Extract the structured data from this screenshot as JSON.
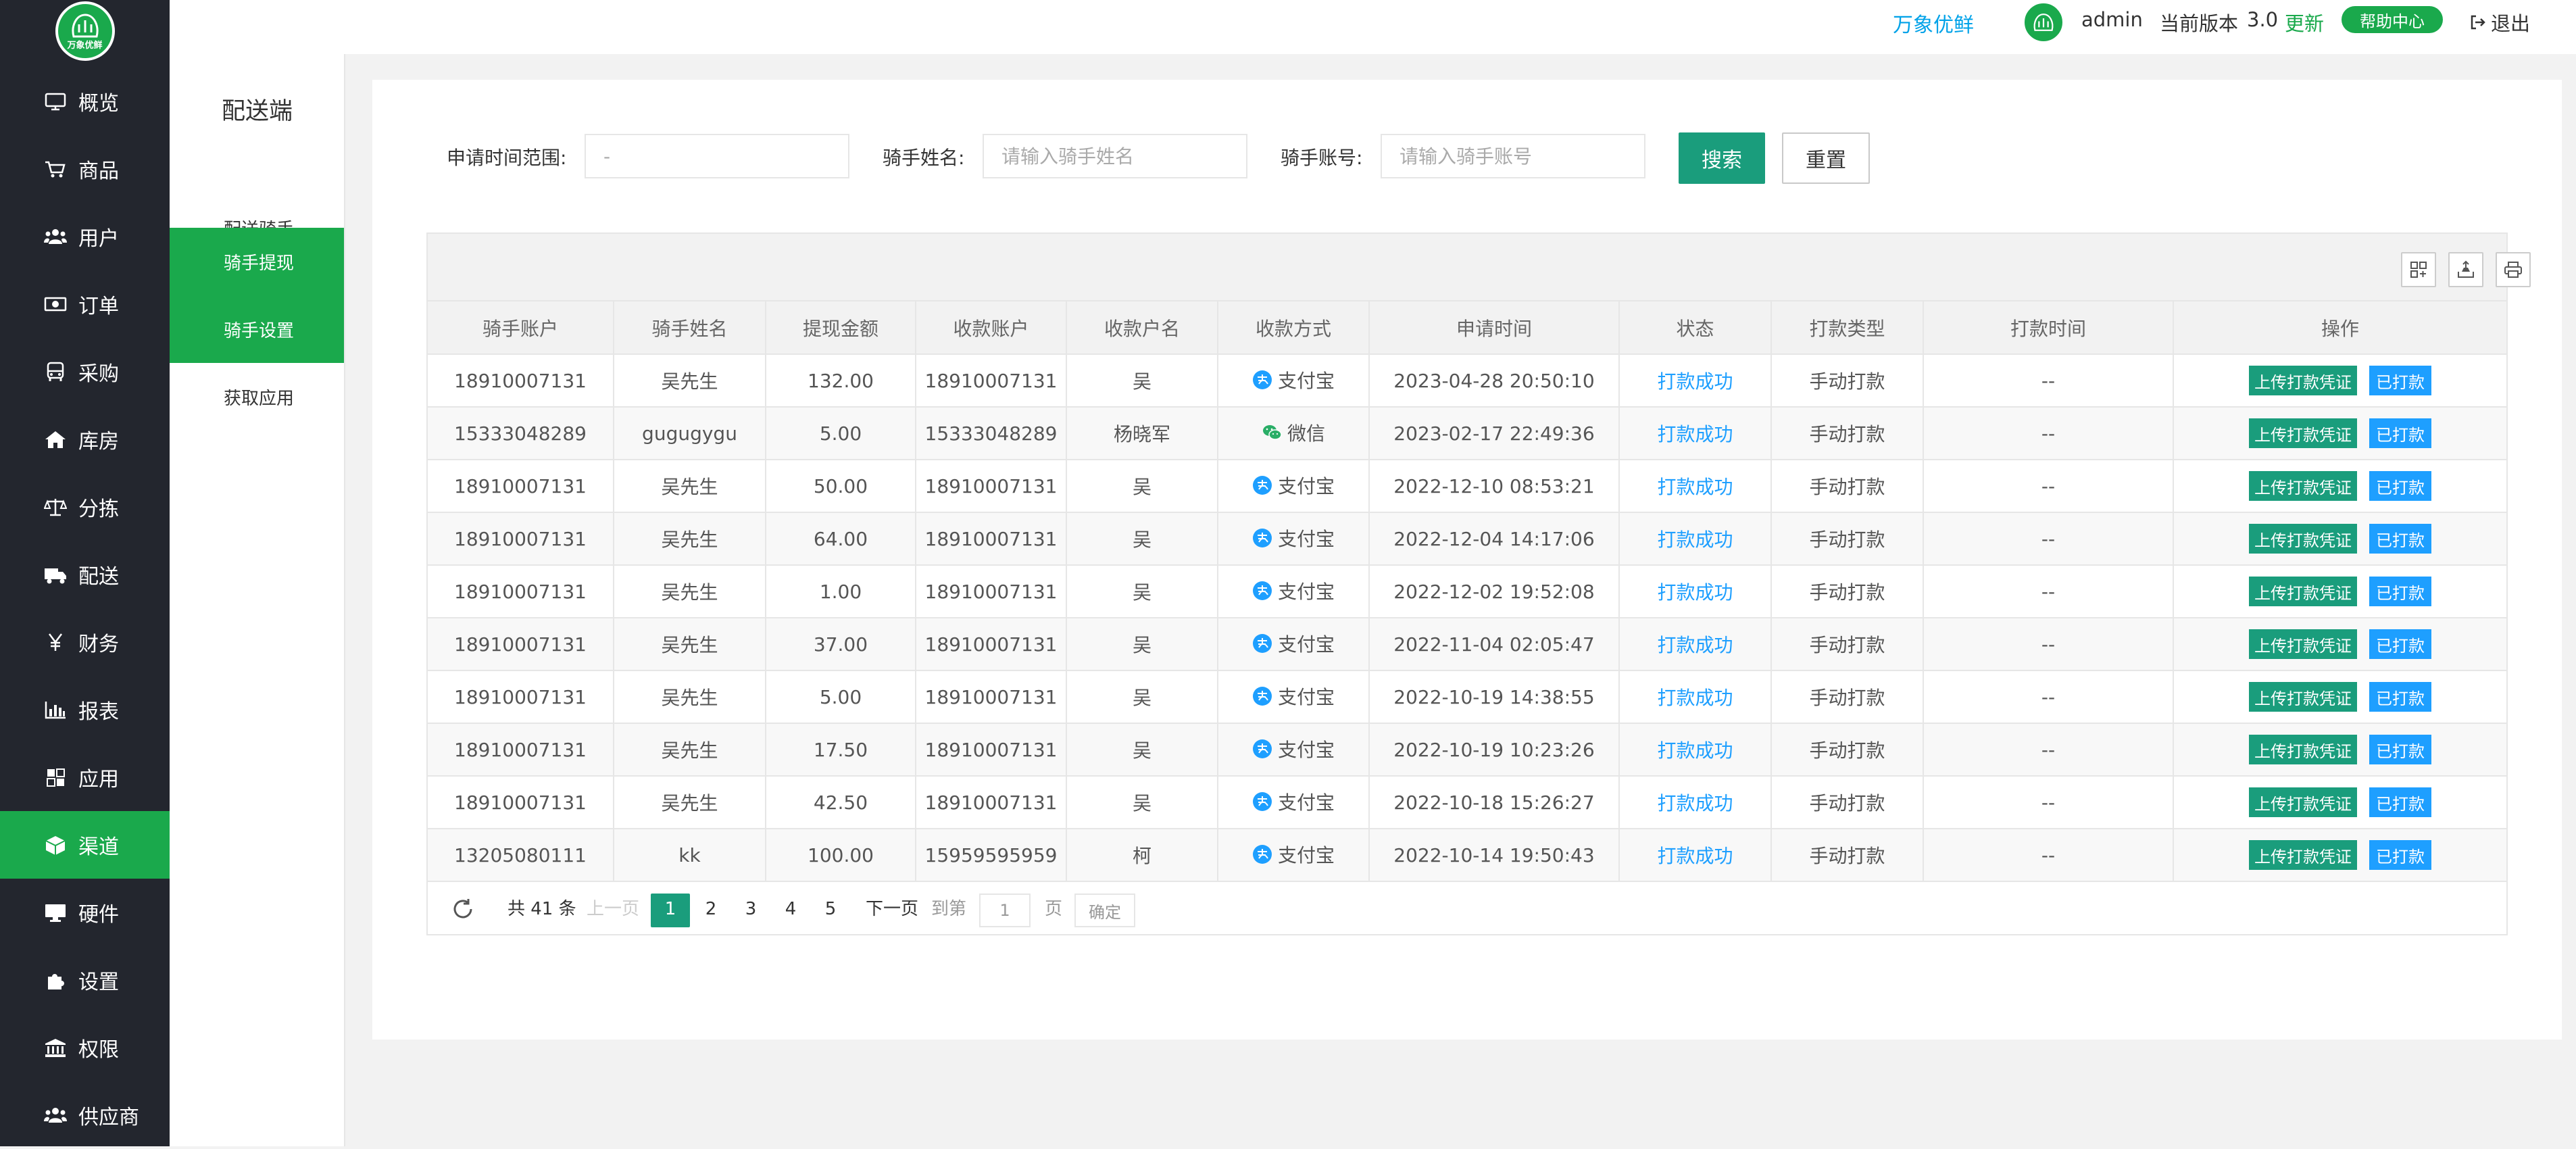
{
  "brand": {
    "logo_text": "万象优鲜"
  },
  "sidebar": {
    "items": [
      {
        "label": "概览",
        "icon": "monitor-icon"
      },
      {
        "label": "商品",
        "icon": "cart-icon"
      },
      {
        "label": "用户",
        "icon": "users-icon"
      },
      {
        "label": "订单",
        "icon": "money-icon"
      },
      {
        "label": "采购",
        "icon": "bus-icon"
      },
      {
        "label": "库房",
        "icon": "home-icon"
      },
      {
        "label": "分拣",
        "icon": "scale-icon"
      },
      {
        "label": "配送",
        "icon": "truck-icon"
      },
      {
        "label": "财务",
        "icon": "yen-icon"
      },
      {
        "label": "报表",
        "icon": "bar-chart-icon"
      },
      {
        "label": "应用",
        "icon": "apps-icon"
      },
      {
        "label": "渠道",
        "icon": "cube-icon",
        "active": true
      },
      {
        "label": "硬件",
        "icon": "desktop-icon"
      },
      {
        "label": "设置",
        "icon": "puzzle-icon"
      },
      {
        "label": "权限",
        "icon": "bank-icon"
      },
      {
        "label": "供应商",
        "icon": "group-icon"
      }
    ]
  },
  "header": {
    "brand": "万象优鲜",
    "username": "admin",
    "version_label": "当前版本",
    "version": "3.0",
    "update": "更新",
    "help": "帮助中心",
    "logout": "退出"
  },
  "subnav": {
    "title": "配送端",
    "items": [
      {
        "label": "配送骑手"
      },
      {
        "label": "骑手提现",
        "active": true
      },
      {
        "label": "骑手设置",
        "active": true
      },
      {
        "label": "获取应用"
      }
    ]
  },
  "search": {
    "time_label": "申请时间范围:",
    "time_placeholder": "-",
    "name_label": "骑手姓名:",
    "name_placeholder": "请输入骑手姓名",
    "account_label": "骑手账号:",
    "account_placeholder": "请输入骑手账号",
    "search_btn": "搜索",
    "reset_btn": "重置"
  },
  "table": {
    "columns": [
      "骑手账户",
      "骑手姓名",
      "提现金额",
      "收款账户",
      "收款户名",
      "收款方式",
      "申请时间",
      "状态",
      "打款类型",
      "打款时间",
      "操作"
    ],
    "upload_label": "上传打款凭证",
    "paid_label": "已打款",
    "rows": [
      {
        "account": "18910007131",
        "name": "吴先生",
        "amount": "132.00",
        "recv": "18910007131",
        "recv_name": "吴",
        "method": "支付宝",
        "method_icon": "alipay-icon",
        "time": "2023-04-28 20:50:10",
        "status": "打款成功",
        "type": "手动打款",
        "pay_time": "--"
      },
      {
        "account": "15333048289",
        "name": "gugugygu",
        "amount": "5.00",
        "recv": "15333048289",
        "recv_name": "杨晓军",
        "method": "微信",
        "method_icon": "wechat-icon",
        "time": "2023-02-17 22:49:36",
        "status": "打款成功",
        "type": "手动打款",
        "pay_time": "--"
      },
      {
        "account": "18910007131",
        "name": "吴先生",
        "amount": "50.00",
        "recv": "18910007131",
        "recv_name": "吴",
        "method": "支付宝",
        "method_icon": "alipay-icon",
        "time": "2022-12-10 08:53:21",
        "status": "打款成功",
        "type": "手动打款",
        "pay_time": "--"
      },
      {
        "account": "18910007131",
        "name": "吴先生",
        "amount": "64.00",
        "recv": "18910007131",
        "recv_name": "吴",
        "method": "支付宝",
        "method_icon": "alipay-icon",
        "time": "2022-12-04 14:17:06",
        "status": "打款成功",
        "type": "手动打款",
        "pay_time": "--"
      },
      {
        "account": "18910007131",
        "name": "吴先生",
        "amount": "1.00",
        "recv": "18910007131",
        "recv_name": "吴",
        "method": "支付宝",
        "method_icon": "alipay-icon",
        "time": "2022-12-02 19:52:08",
        "status": "打款成功",
        "type": "手动打款",
        "pay_time": "--"
      },
      {
        "account": "18910007131",
        "name": "吴先生",
        "amount": "37.00",
        "recv": "18910007131",
        "recv_name": "吴",
        "method": "支付宝",
        "method_icon": "alipay-icon",
        "time": "2022-11-04 02:05:47",
        "status": "打款成功",
        "type": "手动打款",
        "pay_time": "--"
      },
      {
        "account": "18910007131",
        "name": "吴先生",
        "amount": "5.00",
        "recv": "18910007131",
        "recv_name": "吴",
        "method": "支付宝",
        "method_icon": "alipay-icon",
        "time": "2022-10-19 14:38:55",
        "status": "打款成功",
        "type": "手动打款",
        "pay_time": "--"
      },
      {
        "account": "18910007131",
        "name": "吴先生",
        "amount": "17.50",
        "recv": "18910007131",
        "recv_name": "吴",
        "method": "支付宝",
        "method_icon": "alipay-icon",
        "time": "2022-10-19 10:23:26",
        "status": "打款成功",
        "type": "手动打款",
        "pay_time": "--"
      },
      {
        "account": "18910007131",
        "name": "吴先生",
        "amount": "42.50",
        "recv": "18910007131",
        "recv_name": "吴",
        "method": "支付宝",
        "method_icon": "alipay-icon",
        "time": "2022-10-18 15:26:27",
        "status": "打款成功",
        "type": "手动打款",
        "pay_time": "--"
      },
      {
        "account": "13205080111",
        "name": "kk",
        "amount": "100.00",
        "recv": "15959595959",
        "recv_name": "柯",
        "method": "支付宝",
        "method_icon": "alipay-icon",
        "time": "2022-10-14 19:50:43",
        "status": "打款成功",
        "type": "手动打款",
        "pay_time": "--"
      }
    ]
  },
  "pager": {
    "total": "共 41 条",
    "prev": "上一页",
    "pages": [
      "1",
      "2",
      "3",
      "4",
      "5"
    ],
    "current": "1",
    "next": "下一页",
    "goto": "到第",
    "goto_value": "1",
    "page_unit": "页",
    "confirm": "确定"
  },
  "colors": {
    "accent": "#1aa94c",
    "primary": "#1a9d7c",
    "link": "#1e9fff",
    "sidebar": "#23262e"
  }
}
